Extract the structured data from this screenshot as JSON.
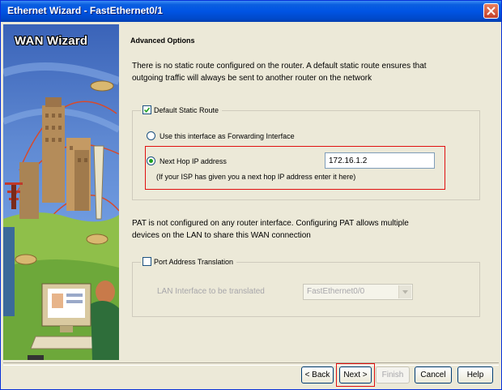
{
  "window": {
    "title": "Ethernet Wizard - FastEthernet0/1"
  },
  "sidebar": {
    "title": "WAN Wizard"
  },
  "main": {
    "heading": "Advanced Options",
    "static_route_text_1": "There is no static route configured on the router. A default static route ensures that",
    "static_route_text_2": "outgoing traffic will always be sent to another router on the network",
    "default_static_route": {
      "label": "Default Static Route",
      "checked": true,
      "option_interface_label": "Use this interface as Forwarding Interface",
      "option_next_hop_label": "Next Hop IP address",
      "selected_option": "next_hop",
      "next_hop_value": "172.16.1.2",
      "note": "(If your ISP has given you a next hop IP address enter it here)"
    },
    "pat_text_1": "PAT is not configured on any router interface. Configuring PAT allows multiple",
    "pat_text_2": "devices on the LAN to share this WAN connection",
    "pat": {
      "label": "Port Address Translation",
      "checked": false,
      "lan_interface_label": "LAN Interface to be translated",
      "lan_interface_value": "FastEthernet0/0"
    }
  },
  "buttons": {
    "back": "< Back",
    "next": "Next >",
    "finish": "Finish",
    "cancel": "Cancel",
    "help": "Help"
  },
  "colors": {
    "highlight": "#e01010",
    "radio_selected": "#21a121"
  }
}
